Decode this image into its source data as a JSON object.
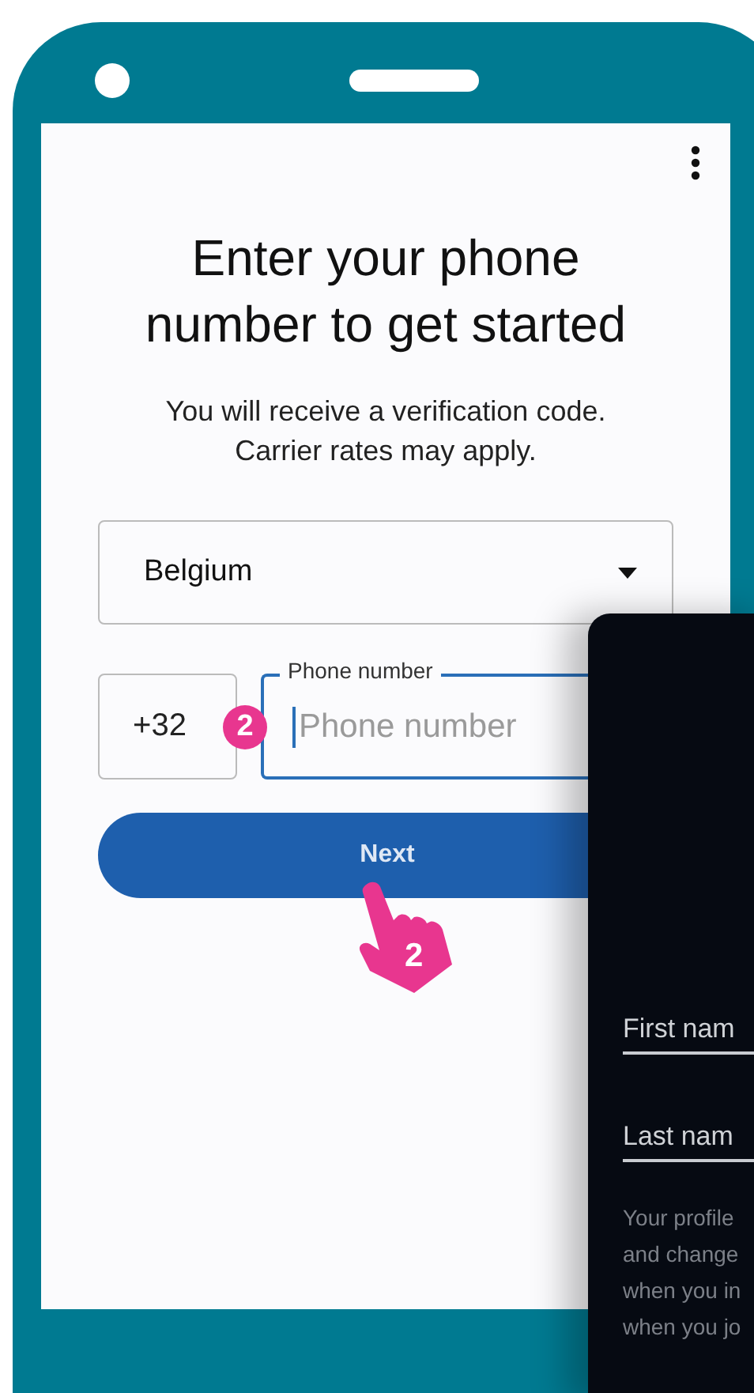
{
  "screen": {
    "title": "Enter your phone number to get started",
    "subtitle": "You will receive a verification code. Carrier rates may apply.",
    "country_select": {
      "value": "Belgium"
    },
    "country_code": "+32",
    "phone_field": {
      "label": "Phone number",
      "placeholder": "Phone number",
      "focused": true
    },
    "next_button": {
      "label": "Next"
    }
  },
  "step_badge": {
    "number": "2"
  },
  "tap_hand": {
    "number": "2"
  },
  "overlay_panel": {
    "fields": [
      {
        "label": "First nam"
      },
      {
        "label": "Last nam"
      }
    ],
    "note_lines": [
      "Your profile",
      "and change",
      "when you in",
      "when you jo"
    ]
  }
}
